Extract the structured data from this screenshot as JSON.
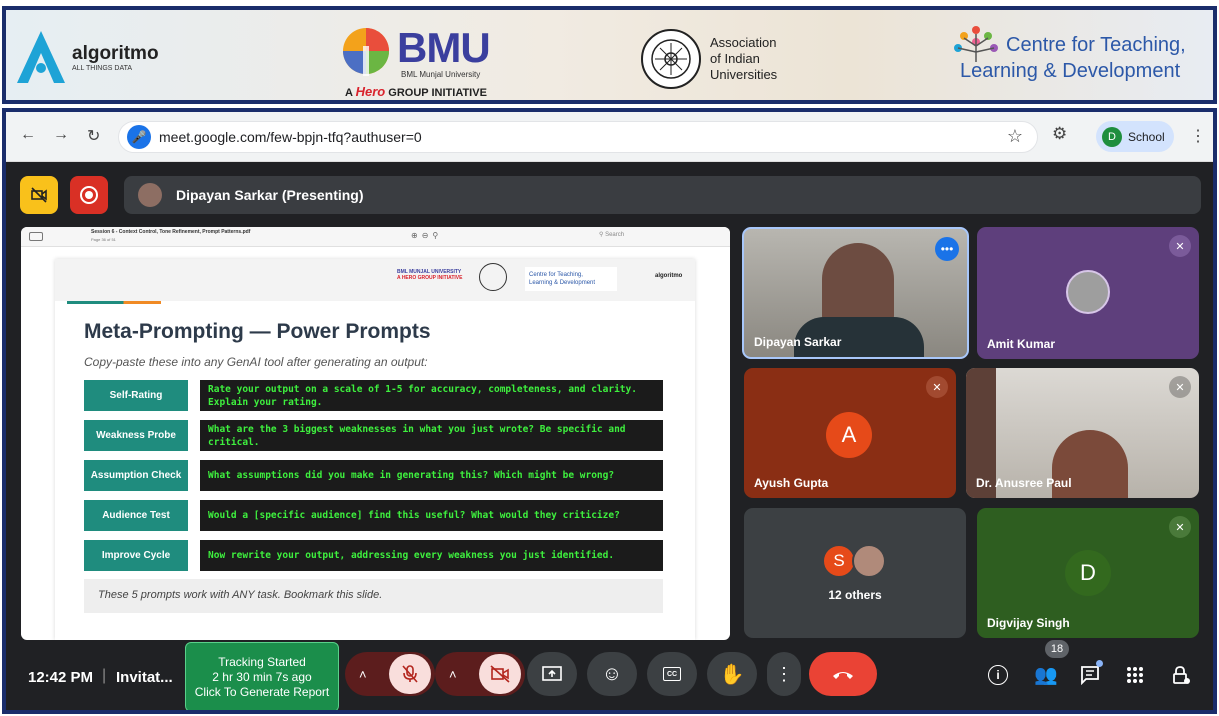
{
  "banner": {
    "algoritmo": {
      "name": "algoritmo",
      "tagline": "ALL THINGS DATA"
    },
    "bmu": {
      "name": "BMU",
      "full": "BML Munjal University",
      "initiative_prefix": "A",
      "initiative_brand": "Hero",
      "initiative_suffix": "GROUP INITIATIVE"
    },
    "aiu": {
      "line1": "Association",
      "line2": "of Indian",
      "line3": "Universities",
      "seal_text": "ASSOCIATION OF INDIAN UNIVERSITIES"
    },
    "ctld": {
      "line1": "Centre for Teaching,",
      "line2": "Learning & Development"
    }
  },
  "browser": {
    "url": "meet.google.com/few-bpjn-tfq?authuser=0",
    "profile_initial": "D",
    "profile_label": "School"
  },
  "meet": {
    "presenter_label": "Dipayan Sarkar (Presenting)",
    "slide": {
      "pdf_name": "Session 6 - Context Control, Tone Refinement, Prompt Patterns.pdf",
      "page_info": "Page 36 of 51",
      "search_placeholder": "Search",
      "header_bmu": "BML MUNJAL UNIVERSITY",
      "header_hero": "A HERO GROUP INITIATIVE",
      "header_ctld1": "Centre for Teaching,",
      "header_ctld2": "Learning & Development",
      "header_algo": "algoritmo",
      "title": "Meta-Prompting — Power Prompts",
      "subtitle": "Copy-paste these into any GenAI tool after generating an output:",
      "rows": [
        {
          "label": "Self-Rating",
          "text": "Rate your output on a scale of 1-5 for accuracy, completeness, and clarity. Explain your rating."
        },
        {
          "label": "Weakness Probe",
          "text": "What are the 3 biggest weaknesses in what you just wrote? Be specific and critical."
        },
        {
          "label": "Assumption Check",
          "text": "What assumptions did you make in generating this? Which might be wrong?"
        },
        {
          "label": "Audience Test",
          "text": "Would a [specific audience] find this useful? What would they criticize?"
        },
        {
          "label": "Improve Cycle",
          "text": "Now rewrite your output, addressing every weakness you just identified."
        }
      ],
      "footer": "These 5 prompts work with ANY task. Bookmark this slide."
    },
    "participants": [
      {
        "name": "Dipayan Sarkar"
      },
      {
        "name": "Amit Kumar"
      },
      {
        "name": "Ayush Gupta",
        "initial": "A"
      },
      {
        "name": "Dr. Anusree Paul"
      },
      {
        "name": "12 others",
        "initial": "S"
      },
      {
        "name": "Digvijay Singh",
        "initial": "D"
      }
    ],
    "bottom": {
      "time": "12:42 PM",
      "separator": "|",
      "meeting": "Invitat...",
      "tracking_line1": "Tracking Started",
      "tracking_line2": "2 hr 30 min 7s ago",
      "tracking_line3": "Click To Generate Report",
      "people_count": "18"
    }
  },
  "colors": {
    "banner_border": "#1a2d6b",
    "teal": "#1f8c7e",
    "end_call": "#ea4335",
    "green_text": "#3ef03e"
  }
}
